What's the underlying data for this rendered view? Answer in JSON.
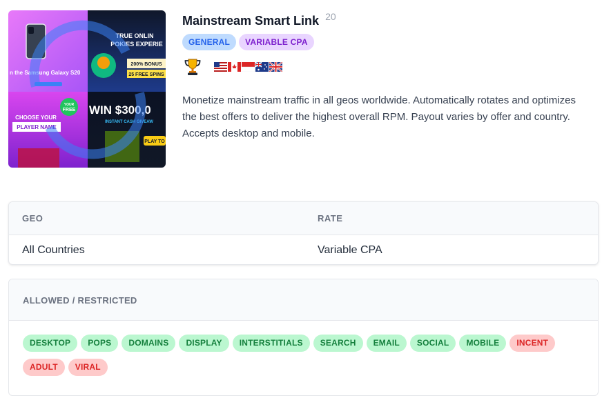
{
  "offer": {
    "title": "Mainstream Smart Link",
    "id": "20",
    "tags": [
      {
        "label": "GENERAL",
        "color": "#2563eb"
      },
      {
        "label": "VARIABLE CPA",
        "color": "#7e22ce"
      }
    ],
    "award_icon": "trophy-icon",
    "geo_flags": [
      "us-flag-icon",
      "ca-flag-icon",
      "id-flag-icon",
      "au-flag-icon",
      "gb-flag-icon"
    ],
    "description": "Monetize mainstream traffic in all geos worldwide. Automatically rotates and optimizes the best offers to deliver the highest overall RPM. Payout varies by offer and country. Accepts desktop and mobile.",
    "thumbnail": {
      "tile_1_text": "n the Samsung Galaxy S20",
      "tile_2_line_1": "TRUE ONLIN",
      "tile_2_line_2": "POKIES EXPERIE",
      "tile_2_bonus": "200% BONUS",
      "tile_2_spins": "25 FREE SPINS",
      "tile_3_line_1": "CHOOSE YOUR",
      "tile_3_line_2": "PLAYER NAME",
      "tile_3_badge_1": "YOUR",
      "tile_3_badge_2": "FREE",
      "tile_4_big": "WIN $300,0",
      "tile_4_sub": "INSTANT CASH GIVEAW",
      "tile_4_button": "PLAY TO"
    }
  },
  "rate_table": {
    "headers": {
      "geo": "GEO",
      "rate": "RATE"
    },
    "row": {
      "geo": "All Countries",
      "rate": "Variable CPA"
    }
  },
  "rules": {
    "title": "ALLOWED / RESTRICTED",
    "allowed_color": "#15803d",
    "restricted_color": "#dc2626",
    "items": [
      {
        "label": "DESKTOP",
        "status": "allowed"
      },
      {
        "label": "POPS",
        "status": "allowed"
      },
      {
        "label": "DOMAINS",
        "status": "allowed"
      },
      {
        "label": "DISPLAY",
        "status": "allowed"
      },
      {
        "label": "INTERSTITIALS",
        "status": "allowed"
      },
      {
        "label": "SEARCH",
        "status": "allowed"
      },
      {
        "label": "EMAIL",
        "status": "allowed"
      },
      {
        "label": "SOCIAL",
        "status": "allowed"
      },
      {
        "label": "MOBILE",
        "status": "allowed"
      },
      {
        "label": "INCENT",
        "status": "restricted"
      },
      {
        "label": "ADULT",
        "status": "restricted"
      },
      {
        "label": "VIRAL",
        "status": "restricted"
      }
    ]
  }
}
